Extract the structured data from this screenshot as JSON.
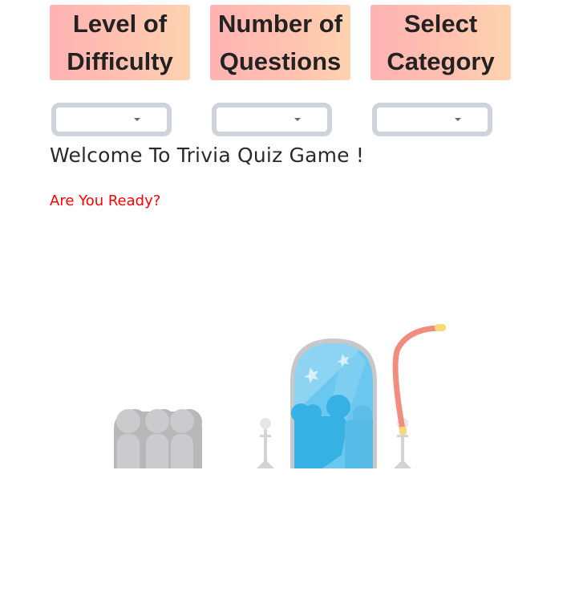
{
  "header": {
    "difficulty": {
      "line1": "Level of",
      "line2": "Difficulty"
    },
    "questions": {
      "line1": "Number of",
      "line2": "Questions"
    },
    "category": {
      "line1": "Select",
      "line2": "Category"
    }
  },
  "selects": {
    "difficulty": {
      "value": ""
    },
    "questions": {
      "value": ""
    },
    "category": {
      "value": ""
    }
  },
  "main": {
    "title": "Welcome To Trivia Quiz Game !",
    "subtitle": "Are You Ready?"
  },
  "colors": {
    "header_gradient_start": "#ffb3b3",
    "header_gradient_end": "#ffd3b0",
    "subtitle": "#ff0000",
    "select_border": "#cfd4db"
  },
  "icons": {
    "dropdown": "chevron-down-icon",
    "illustration": "stage-door-audience-illustration"
  }
}
